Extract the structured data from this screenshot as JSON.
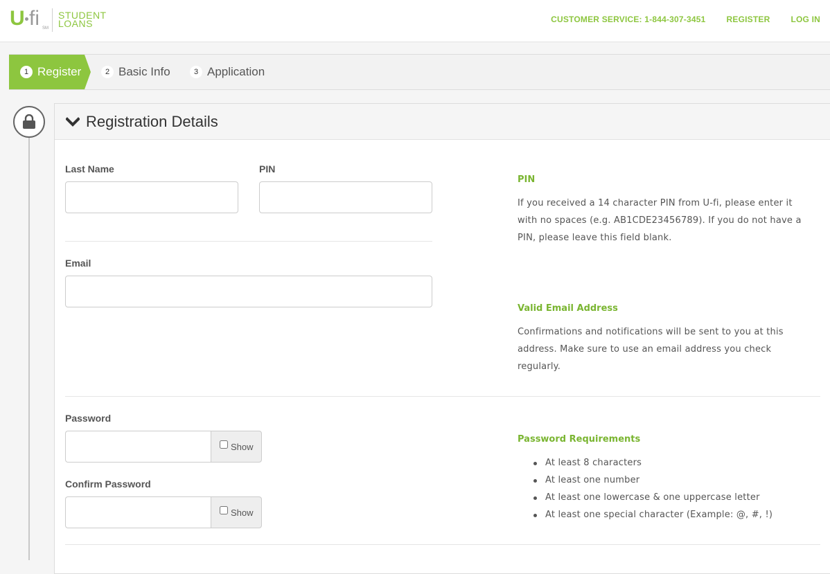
{
  "brand": {
    "logo_u": "U",
    "logo_fi": "fi",
    "logo_sm": "SM",
    "logo_line1": "STUDENT",
    "logo_line2": "LOANS",
    "accent_color": "#8dc63f"
  },
  "nav": {
    "customer_service": "CUSTOMER SERVICE: 1-844-307-3451",
    "register": "REGISTER",
    "login": "LOG IN"
  },
  "steps": [
    {
      "number": "1",
      "label": "Register",
      "active": true
    },
    {
      "number": "2",
      "label": "Basic Info",
      "active": false
    },
    {
      "number": "3",
      "label": "Application",
      "active": false
    }
  ],
  "panel": {
    "title": "Registration Details",
    "lock_icon": "lock-icon",
    "chevron_icon": "chevron-down-icon"
  },
  "form": {
    "last_name_label": "Last Name",
    "last_name_value": "",
    "pin_label": "PIN",
    "pin_value": "",
    "email_label": "Email",
    "email_value": "",
    "password_label": "Password",
    "password_show": "Show",
    "confirm_password_label": "Confirm Password",
    "confirm_password_show": "Show"
  },
  "help": {
    "pin_title": "PIN",
    "pin_text_1": "If you received a 14 character PIN from U-fi, please enter it",
    "pin_text_2": "with no spaces (e.g. AB1CDE23456789). If you do not have a",
    "pin_text_3": "PIN, please leave this field blank.",
    "email_title": "Valid Email Address",
    "email_text_1": "Confirmations and notifications will be sent to you at this",
    "email_text_2": "address. Make sure to use an email address you check",
    "email_text_3": "regularly.",
    "password_title": "Password Requirements",
    "password_reqs": [
      "At least 8 characters",
      "At least one number",
      "At least one lowercase & one uppercase letter",
      "At least one special character (Example: @, #, !)"
    ]
  }
}
